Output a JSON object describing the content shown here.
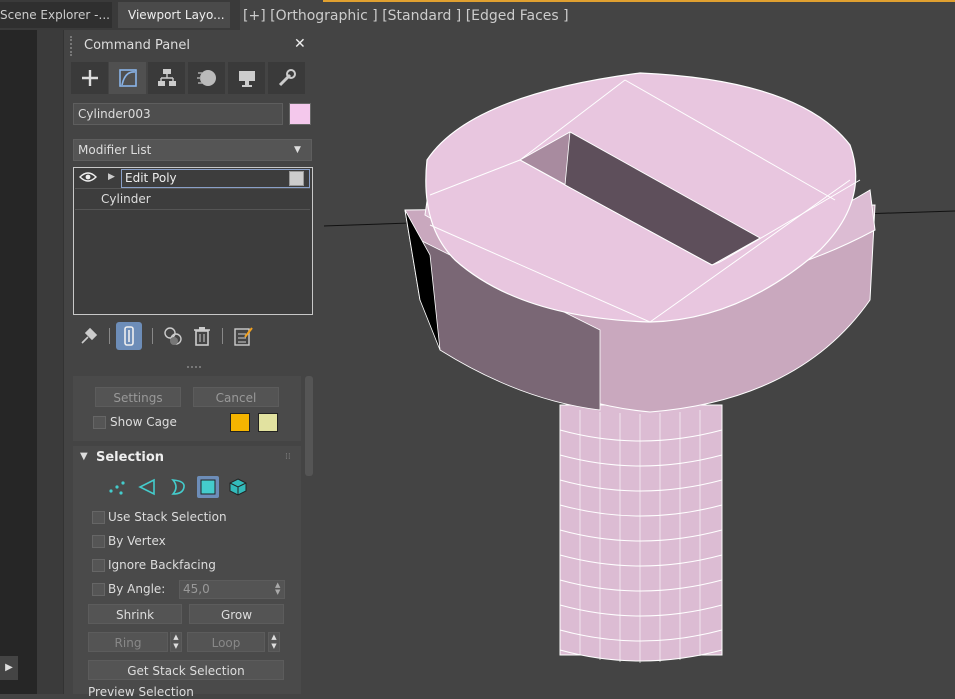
{
  "tabs": [
    "Scene Explorer -...",
    "Viewport Layo..."
  ],
  "viewport": {
    "label": "[+] [Orthographic ] [Standard ] [Edged Faces ]",
    "object_color": "#e7c3dd"
  },
  "command_panel": {
    "title": "Command Panel",
    "close": "✕",
    "tabs": [
      "create-icon",
      "modify-icon",
      "hierarchy-icon",
      "motion-icon",
      "display-icon",
      "utilities-icon"
    ],
    "object_name": "Cylinder003",
    "object_color": "#f4c8ec",
    "modifier_list": "Modifier List",
    "stack": [
      "Edit Poly",
      "Cylinder"
    ],
    "stack_toolbar": [
      "pin-stack-icon",
      "show-end-result-icon",
      "make-unique-icon",
      "remove-modifier-icon",
      "configure-modifier-sets-icon"
    ]
  },
  "cage": {
    "settings": "Settings",
    "cancel": "Cancel",
    "show_cage": "Show Cage",
    "cage_color1": "#f5b400",
    "cage_color2": "#e2e2a0"
  },
  "selection": {
    "title": "Selection",
    "modes": [
      "vertex-icon",
      "edge-icon",
      "border-icon",
      "polygon-icon",
      "element-icon"
    ],
    "use_stack_selection": "Use Stack Selection",
    "by_vertex": "By Vertex",
    "ignore_backfacing": "Ignore Backfacing",
    "by_angle": "By Angle:",
    "angle_value": "45,0",
    "shrink": "Shrink",
    "grow": "Grow",
    "ring": "Ring",
    "loop": "Loop",
    "get_stack_selection": "Get Stack Selection",
    "preview_selection": "Preview Selection"
  }
}
